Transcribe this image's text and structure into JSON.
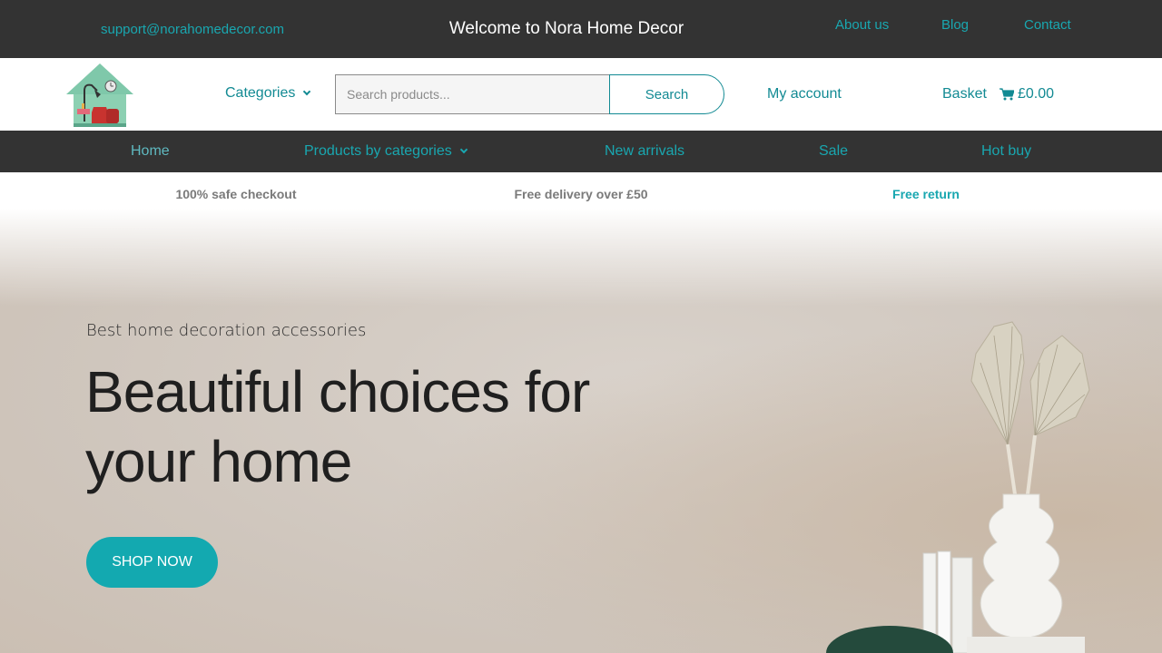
{
  "topbar": {
    "email": "support@norahomedecor.com",
    "welcome": "Welcome to Nora Home Decor",
    "links": [
      "About us",
      "Blog",
      "Contact"
    ]
  },
  "header": {
    "categories_label": "Categories",
    "search": {
      "placeholder": "Search products...",
      "button": "Search"
    },
    "my_account": "My account",
    "basket": "Basket",
    "cart_total": "£0.00"
  },
  "nav": {
    "items": [
      "Home",
      "Products by categories",
      "New arrivals",
      "Sale",
      "Hot buy"
    ]
  },
  "features": [
    "100% safe checkout",
    "Free delivery over £50",
    "Free return"
  ],
  "hero": {
    "subtitle": "Best home decoration accessories",
    "title": "Beautiful choices for your home",
    "cta": "SHOP NOW"
  },
  "colors": {
    "accent": "#13a9b0",
    "dark_bar": "#333333",
    "link": "#128a93"
  }
}
